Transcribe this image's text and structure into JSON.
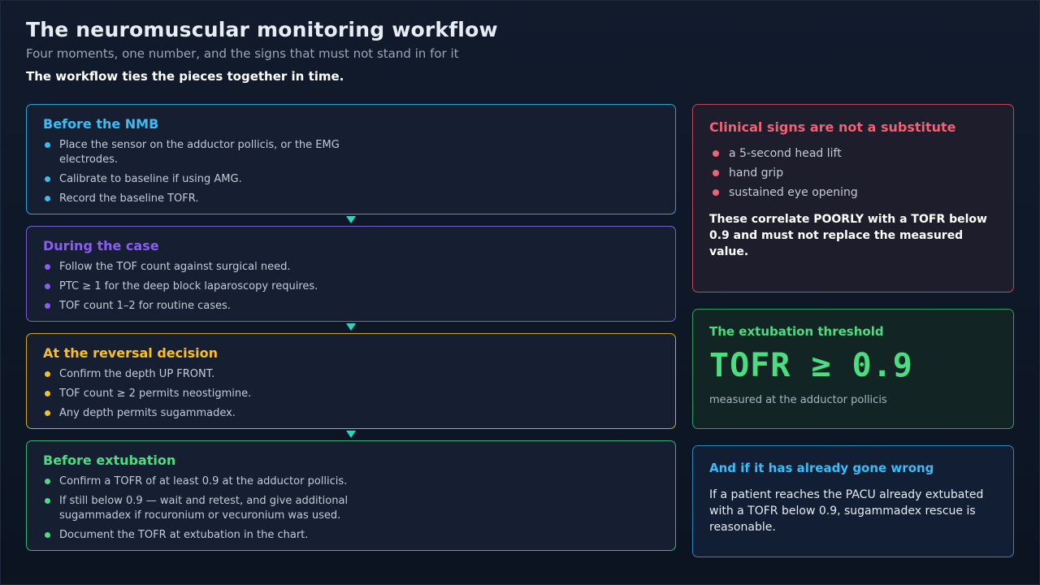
{
  "header": {
    "title": "The neuromuscular monitoring workflow",
    "subtitle": "Four moments, one number, and the signs that must not stand in for it",
    "lead": "The workflow ties the pieces together in time."
  },
  "steps": [
    {
      "title": "Before the NMB",
      "items": [
        "Place the sensor on the adductor pollicis, or the EMG electrodes.",
        "Calibrate to baseline if using AMG.",
        "Record the baseline TOFR."
      ]
    },
    {
      "title": "During the case",
      "items": [
        "Follow the TOF count against surgical need.",
        "PTC ≥ 1 for the deep block laparoscopy requires.",
        "TOF count 1–2 for routine cases."
      ]
    },
    {
      "title": "At the reversal decision",
      "items": [
        "Confirm the depth UP FRONT.",
        "TOF count ≥ 2 permits neostigmine.",
        "Any depth permits sugammadex."
      ]
    },
    {
      "title": "Before extubation",
      "items": [
        "Confirm a TOFR of at least 0.9 at the adductor pollicis.",
        "If still below 0.9 — wait and retest, and give additional sugammadex if rocuronium or vecuronium was used.",
        "Document the TOFR at extubation in the chart."
      ]
    }
  ],
  "signs": {
    "title": "Clinical signs are not a substitute",
    "items": [
      "a 5-second head lift",
      "hand grip",
      "sustained eye opening"
    ],
    "note": "These correlate POORLY with a TOFR below 0.9 and must not replace the measured value."
  },
  "threshold": {
    "title": "The extubation threshold",
    "value": "TOFR ≥ 0.9",
    "caption": "measured at the adductor pollicis"
  },
  "rescue": {
    "title": "And if it has already gone wrong",
    "body": "If a patient reaches the PACU already extubated with a TOFR below 0.9, sugammadex rescue is reasonable."
  },
  "colors": {
    "step1": "#38bdf8",
    "step2": "#8b5cf6",
    "step3": "#fbbf24",
    "step4": "#4ade80",
    "arrow": "#2dd4bf",
    "warning": "#f06273"
  }
}
